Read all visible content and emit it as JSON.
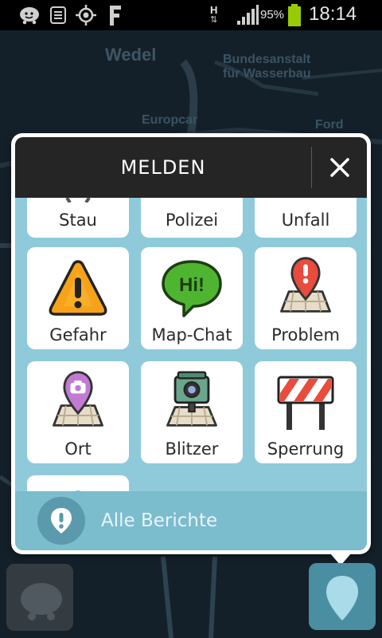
{
  "status_bar": {
    "battery_percent": "95%",
    "time": "18:14",
    "network": "H",
    "icons": [
      "waze-icon",
      "notes-icon",
      "gps-icon",
      "facebook-icon",
      "signal-icon",
      "battery-icon"
    ]
  },
  "map": {
    "labels": [
      "Wedel",
      "Bundesanstalt",
      "für Wasserbau",
      "Europcar",
      "Ford"
    ]
  },
  "dialog": {
    "title": "MELDEN",
    "close_icon": "close-icon",
    "tiles": [
      {
        "label": "Stau",
        "icon": "traffic-jam-icon"
      },
      {
        "label": "Polizei",
        "icon": "police-icon"
      },
      {
        "label": "Unfall",
        "icon": "accident-icon"
      },
      {
        "label": "Gefahr",
        "icon": "hazard-icon"
      },
      {
        "label": "Map-Chat",
        "icon": "chat-bubble-icon",
        "icon_text": "Hi!"
      },
      {
        "label": "Problem",
        "icon": "map-problem-icon"
      },
      {
        "label": "Ort",
        "icon": "camera-place-icon"
      },
      {
        "label": "Blitzer",
        "icon": "speed-camera-icon"
      },
      {
        "label": "Sperrung",
        "icon": "road-closure-icon"
      }
    ],
    "footer": {
      "label": "Alle Berichte",
      "icon": "report-pin-icon"
    }
  },
  "colors": {
    "header": "#252525",
    "panel": "#8fcadb",
    "footer": "#7bbccd",
    "hazard": "#f6a21a",
    "chat": "#4fb531",
    "problem": "#e94b3c",
    "place": "#c27bd3",
    "battery": "#99cc00"
  }
}
